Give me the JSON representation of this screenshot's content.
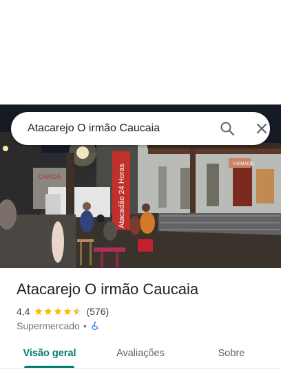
{
  "search": {
    "query": "Atacarejo O irmão Caucaia"
  },
  "photo": {
    "store_banner_text": "Atacadão 24 Horas",
    "shop_sign_left": "CARGA",
    "shop_sign_right": "FARMÁCIA"
  },
  "place": {
    "name": "Atacarejo O irmão Caucaia",
    "rating": "4,4",
    "stars": 4.4,
    "review_count": "(576)",
    "category": "Supermercado",
    "separator": "•"
  },
  "tabs": [
    {
      "label": "Visão geral",
      "active": true
    },
    {
      "label": "Avaliações",
      "active": false
    },
    {
      "label": "Sobre",
      "active": false
    }
  ],
  "colors": {
    "accent": "#00796b",
    "star": "#fbbc04",
    "wheelchair": "#1a73e8"
  }
}
